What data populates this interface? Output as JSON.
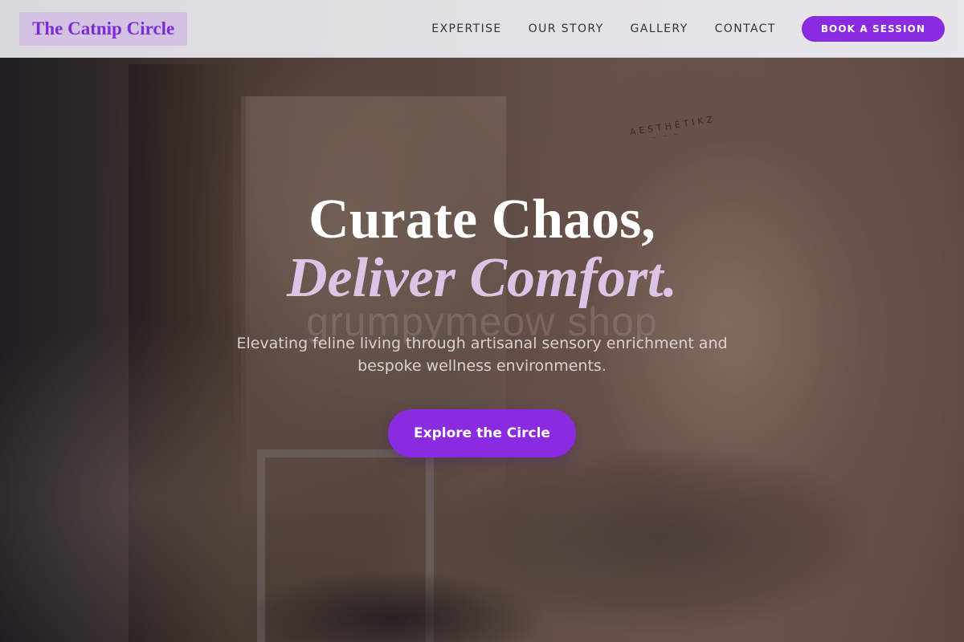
{
  "brand": {
    "logo_text": "The Catnip Circle"
  },
  "nav": {
    "links": [
      "EXPERTISE",
      "OUR STORY",
      "GALLERY",
      "CONTACT"
    ],
    "cta_label": "BOOK A SESSION"
  },
  "hero": {
    "headline_line1": "Curate Chaos,",
    "headline_line2": "Deliver Comfort.",
    "subtitle": "Elevating feline living through artisanal sensory enrichment and bespoke wellness environments.",
    "cta_label": "Explore the Circle",
    "watermark": "grumpymeow shop",
    "shirt_print": "AESTHÉTIKZ",
    "background_icon": "person-in-sweatshirt-photo"
  },
  "colors": {
    "accent": "#8a2be2",
    "logo_bg": "#d4c2e3",
    "logo_text": "#7b2cd6",
    "headline_accent": "#dcc4e6"
  }
}
